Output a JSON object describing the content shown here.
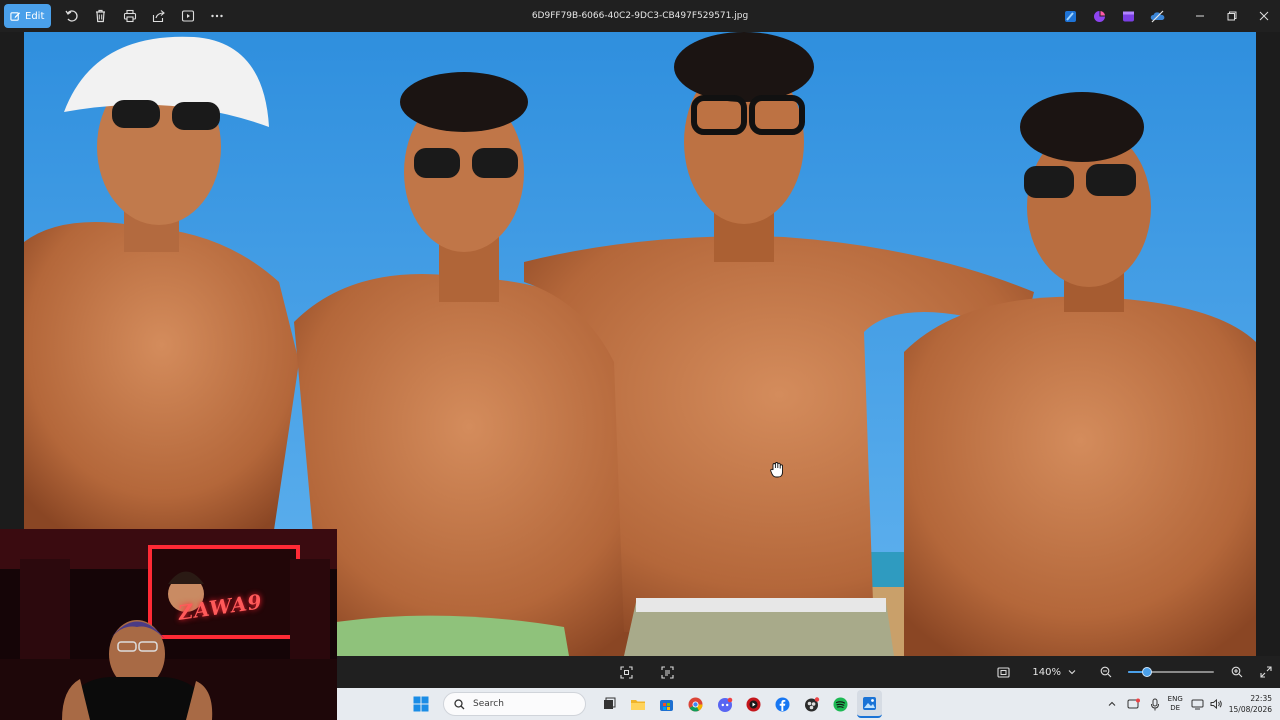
{
  "window": {
    "file_name": "6D9FF79B-6066-40C2-9DC3-CB497F529571.jpg"
  },
  "toolbar": {
    "edit_label": "Edit",
    "buttons": [
      "rotate-icon",
      "delete-icon",
      "print-icon",
      "share-icon",
      "slideshow-icon",
      "more-icon"
    ],
    "app_icons": [
      "photos-editor-icon",
      "clipchamp-icon",
      "video-editor-icon",
      "onedrive-icon"
    ],
    "window_controls": [
      "minimize-icon",
      "restore-icon",
      "close-icon"
    ]
  },
  "viewer_bar": {
    "zoom_label": "140%",
    "zoom_level_fraction": 0.18,
    "center_buttons": [
      "fit-icon",
      "info-icon"
    ],
    "right_buttons": [
      "actual-size-icon",
      "chevron-down-icon",
      "zoom-out-icon",
      "zoom-in-icon",
      "fullscreen-icon"
    ]
  },
  "webcam": {
    "sign_text": "ZAWA9"
  },
  "taskbar": {
    "search_placeholder": "Search",
    "apps": [
      "file-explorer-icon",
      "store-icon",
      "chrome-icon",
      "discord-icon",
      "media-player-icon",
      "facebook-icon",
      "obs-icon",
      "spotify-icon",
      "photos-icon"
    ],
    "tray": {
      "lang_top": "ENG",
      "lang_bottom": "DE",
      "time": "22:35",
      "date": "15/08/2026"
    }
  },
  "colors": {
    "accent": "#4aa0ea",
    "toolbar_bg": "#202020",
    "taskbar_bg": "#e7ebf0",
    "sky": "#3f9be4"
  }
}
